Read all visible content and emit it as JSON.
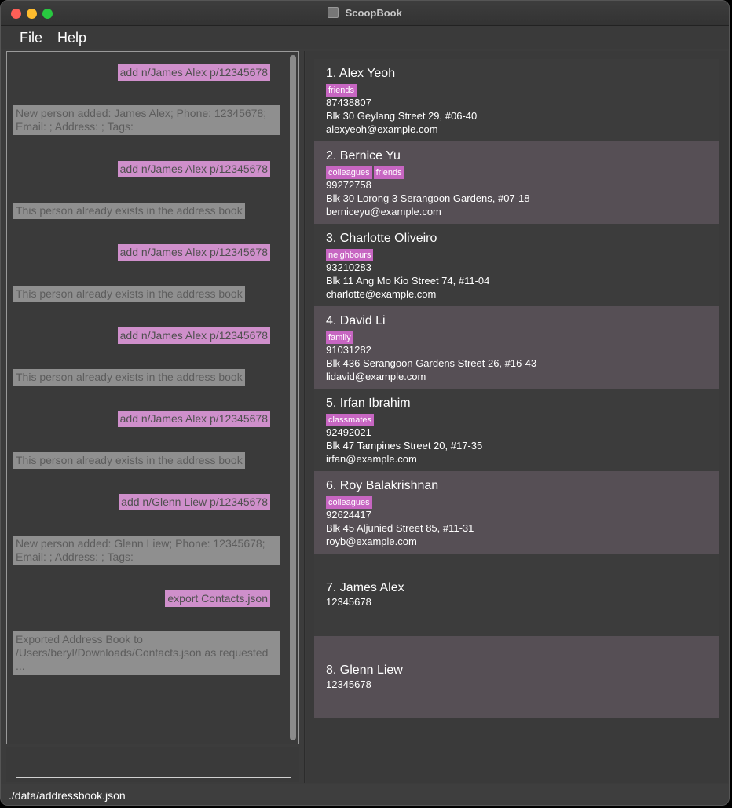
{
  "window": {
    "title": "ScoopBook"
  },
  "menu": {
    "file": "File",
    "help": "Help"
  },
  "chat": [
    {
      "kind": "cmd",
      "text": "add n/James Alex p/12345678"
    },
    {
      "kind": "res",
      "text": "New person added: James Alex; Phone: 12345678; Email: ; Address: ; Tags:"
    },
    {
      "kind": "cmd",
      "text": "add n/James Alex p/12345678"
    },
    {
      "kind": "res",
      "text": "This person already exists in the address book"
    },
    {
      "kind": "cmd",
      "text": "add n/James Alex p/12345678"
    },
    {
      "kind": "res",
      "text": "This person already exists in the address book"
    },
    {
      "kind": "cmd",
      "text": "add n/James Alex p/12345678"
    },
    {
      "kind": "res",
      "text": "This person already exists in the address book"
    },
    {
      "kind": "cmd",
      "text": "add n/James Alex p/12345678"
    },
    {
      "kind": "res",
      "text": "This person already exists in the address book"
    },
    {
      "kind": "cmd",
      "text": "add n/Glenn Liew p/12345678"
    },
    {
      "kind": "res",
      "text": "New person added: Glenn Liew; Phone: 12345678; Email: ; Address: ; Tags:"
    },
    {
      "kind": "cmd",
      "text": "export Contacts.json"
    },
    {
      "kind": "res",
      "text": "Exported Address Book to /Users/beryl/Downloads/Contacts.json as requested ..."
    }
  ],
  "persons": [
    {
      "index": "1.",
      "name": "Alex Yeoh",
      "tags": [
        "friends"
      ],
      "phone": "87438807",
      "address": "Blk 30 Geylang Street 29, #06-40",
      "email": "alexyeoh@example.com"
    },
    {
      "index": "2.",
      "name": "Bernice Yu",
      "tags": [
        "colleagues",
        "friends"
      ],
      "phone": "99272758",
      "address": "Blk 30 Lorong 3 Serangoon Gardens, #07-18",
      "email": "berniceyu@example.com"
    },
    {
      "index": "3.",
      "name": "Charlotte Oliveiro",
      "tags": [
        "neighbours"
      ],
      "phone": "93210283",
      "address": "Blk 11 Ang Mo Kio Street 74, #11-04",
      "email": "charlotte@example.com"
    },
    {
      "index": "4.",
      "name": "David Li",
      "tags": [
        "family"
      ],
      "phone": "91031282",
      "address": "Blk 436 Serangoon Gardens Street 26, #16-43",
      "email": "lidavid@example.com"
    },
    {
      "index": "5.",
      "name": "Irfan Ibrahim",
      "tags": [
        "classmates"
      ],
      "phone": "92492021",
      "address": "Blk 47 Tampines Street 20, #17-35",
      "email": "irfan@example.com"
    },
    {
      "index": "6.",
      "name": "Roy Balakrishnan",
      "tags": [
        "colleagues"
      ],
      "phone": "92624417",
      "address": "Blk 45 Aljunied Street 85, #11-31",
      "email": "royb@example.com"
    },
    {
      "index": "7.",
      "name": "James Alex",
      "tags": [],
      "phone": "12345678",
      "address": "",
      "email": ""
    },
    {
      "index": "8.",
      "name": "Glenn Liew",
      "tags": [],
      "phone": "12345678",
      "address": "",
      "email": ""
    }
  ],
  "status": {
    "path": "./data/addressbook.json"
  },
  "colors": {
    "tag": "#c766c2",
    "command_bubble": "#cf8fcb",
    "result_bubble": "#8f8f8f",
    "card_alt": "#564f55"
  }
}
